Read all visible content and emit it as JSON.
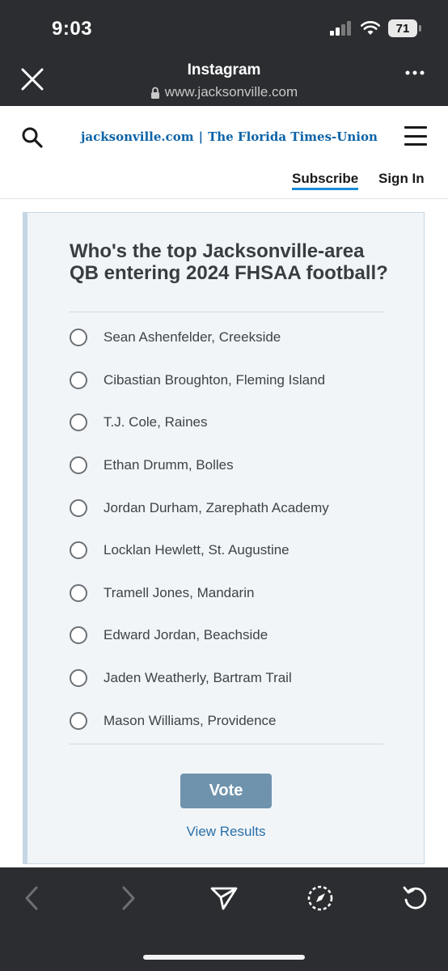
{
  "status_bar": {
    "time": "9:03",
    "battery": "71"
  },
  "browser": {
    "title": "Instagram",
    "url": "www.jacksonville.com"
  },
  "site": {
    "domain": "jacksonville.com",
    "separator": "|",
    "publication": "The Florida Times-Union",
    "subscribe_label": "Subscribe",
    "signin_label": "Sign In"
  },
  "poll": {
    "question": "Who's the top Jacksonville-area QB entering 2024 FHSAA football?",
    "options": [
      "Sean Ashenfelder, Creekside",
      "Cibastian Broughton, Fleming Island",
      "T.J. Cole, Raines",
      "Ethan Drumm, Bolles",
      "Jordan Durham, Zarephath Academy",
      "Locklan Hewlett, St. Augustine",
      "Tramell Jones, Mandarin",
      "Edward Jordan, Beachside",
      "Jaden Weatherly, Bartram Trail",
      "Mason Williams, Providence"
    ],
    "vote_label": "Vote",
    "results_label": "View Results"
  },
  "colors": {
    "chrome": "#2b2d30",
    "brand_blue": "#0b63a8",
    "vote_button": "#6f93ad",
    "link_blue": "#2a6fa8",
    "card_bg": "#f1f5f8"
  },
  "icons": {
    "close": "close-icon",
    "lock": "lock-icon",
    "more": "more-icon",
    "search": "search-icon",
    "menu": "hamburger-menu-icon",
    "back": "chevron-left-icon",
    "forward": "chevron-right-icon",
    "share": "send-icon",
    "safari": "compass-icon",
    "reload": "reload-icon"
  }
}
